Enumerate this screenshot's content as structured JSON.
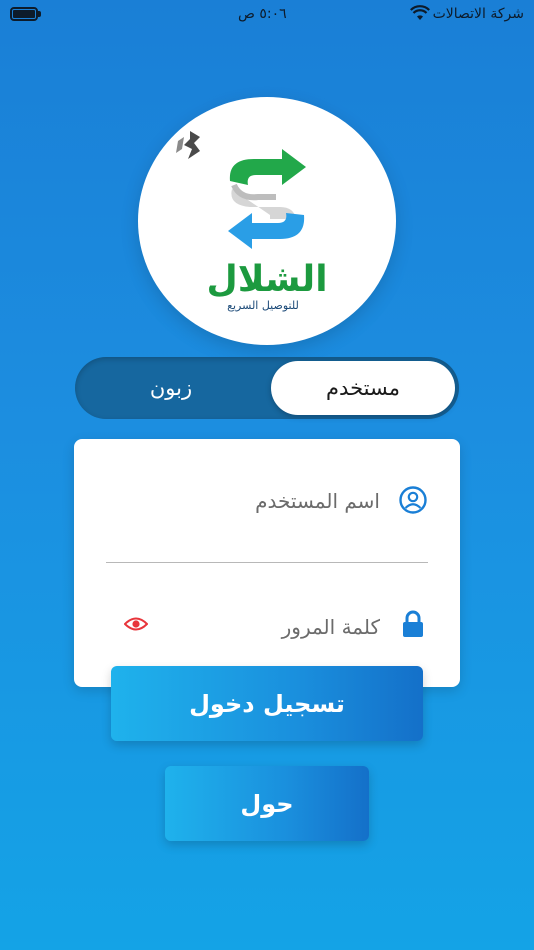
{
  "status_bar": {
    "carrier": "شركة الاتصالات",
    "time": "٥:٠٦ ص",
    "wifi_icon": "wifi-icon",
    "battery_icon": "battery-icon",
    "battery_level": 1.0
  },
  "logo": {
    "name": "الشلال",
    "tagline": "للتوصيل السريع",
    "colors": {
      "green": "#1c9a3f",
      "blue": "#1a8fdd"
    }
  },
  "segment": {
    "active_label": "مستخدم",
    "inactive_label": "زبون"
  },
  "form": {
    "username_placeholder": "اسم المستخدم",
    "password_placeholder": "كلمة المرور",
    "user_icon": "user-circle-icon",
    "lock_icon": "lock-icon",
    "eye_icon": "eye-icon",
    "icon_color": "#1a7fd6",
    "eye_color": "#e8353b"
  },
  "buttons": {
    "login_label": "تسجيل دخول",
    "about_label": "حول"
  }
}
